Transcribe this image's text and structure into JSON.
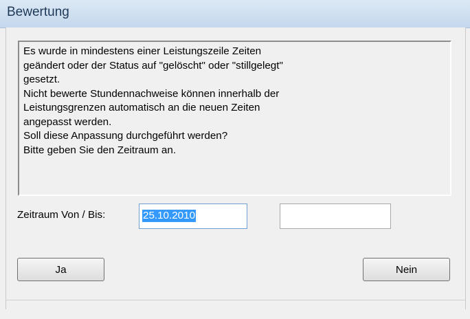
{
  "window": {
    "title": "Bewertung"
  },
  "message": {
    "lines": [
      "Es wurde in mindestens einer Leistungszeile Zeiten",
      "geändert oder der Status auf \"gelöscht\" oder \"stillgelegt\"",
      "gesetzt.",
      "Nicht bewerte Stundennachweise können innerhalb der",
      "Leistungsgrenzen automatisch an die neuen Zeiten",
      "angepasst werden.",
      "Soll diese Anpassung durchgeführt werden?",
      "Bitte geben Sie den Zeitraum an."
    ]
  },
  "period": {
    "label": "Zeitraum Von / Bis:",
    "from_value": "25.10.2010",
    "to_value": ""
  },
  "buttons": {
    "yes": "Ja",
    "no": "Nein"
  }
}
